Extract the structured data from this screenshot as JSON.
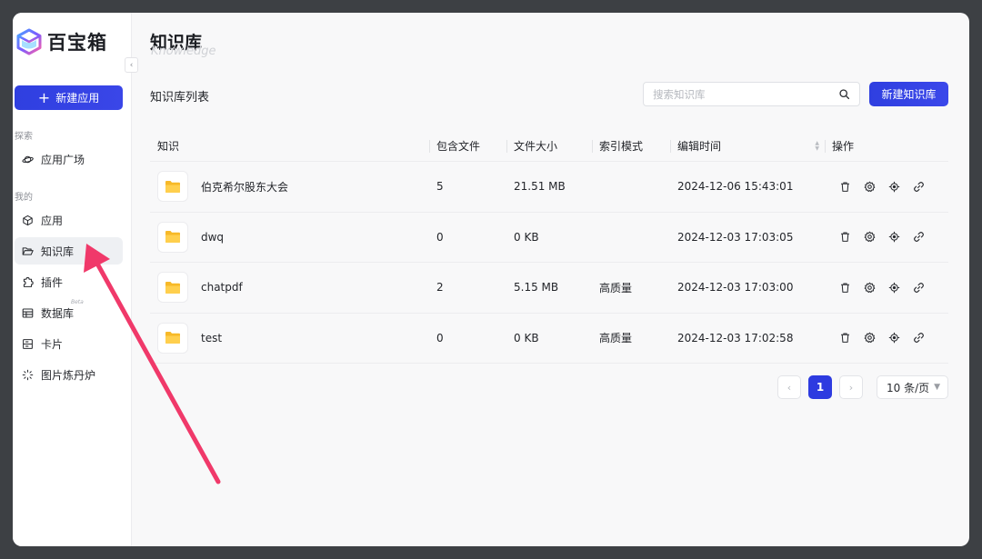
{
  "brand": {
    "name": "百宝箱"
  },
  "sidebar": {
    "collapse_label": "‹",
    "new_app_label": "新建应用",
    "explore_label": "探索",
    "mine_label": "我的",
    "beta_label": "Beta",
    "items": [
      {
        "label": "应用广场",
        "icon": "planet-icon"
      },
      {
        "label": "应用",
        "icon": "cube-icon"
      },
      {
        "label": "知识库",
        "icon": "folder-open-icon",
        "active": true
      },
      {
        "label": "插件",
        "icon": "puzzle-icon"
      },
      {
        "label": "数据库",
        "icon": "table-icon"
      },
      {
        "label": "卡片",
        "icon": "card-icon"
      },
      {
        "label": "图片炼丹炉",
        "icon": "sparkle-icon"
      }
    ]
  },
  "main": {
    "title": "知识库",
    "subtitle": "Knowledge",
    "list_title": "知识库列表",
    "search_placeholder": "搜索知识库",
    "new_kb_label": "新建知识库"
  },
  "table": {
    "headers": [
      "知识",
      "包含文件",
      "文件大小",
      "索引模式",
      "编辑时间",
      "操作"
    ],
    "rows": [
      {
        "name": "伯克希尔股东大会",
        "files": "5",
        "size": "21.51 MB",
        "index_mode": "",
        "edited": "2024-12-06 15:43:01"
      },
      {
        "name": "dwq",
        "files": "0",
        "size": "0 KB",
        "index_mode": "",
        "edited": "2024-12-03 17:03:05"
      },
      {
        "name": "chatpdf",
        "files": "2",
        "size": "5.15 MB",
        "index_mode": "高质量",
        "edited": "2024-12-03 17:03:00"
      },
      {
        "name": "test",
        "files": "0",
        "size": "0 KB",
        "index_mode": "高质量",
        "edited": "2024-12-03 17:02:58"
      }
    ]
  },
  "pagination": {
    "prev": "‹",
    "next": "›",
    "current_page": "1",
    "page_size": "10 条/页"
  },
  "colors": {
    "accent": "#2f3fe0",
    "annotation_arrow": "#f0396a",
    "folder": "#f7b928"
  }
}
